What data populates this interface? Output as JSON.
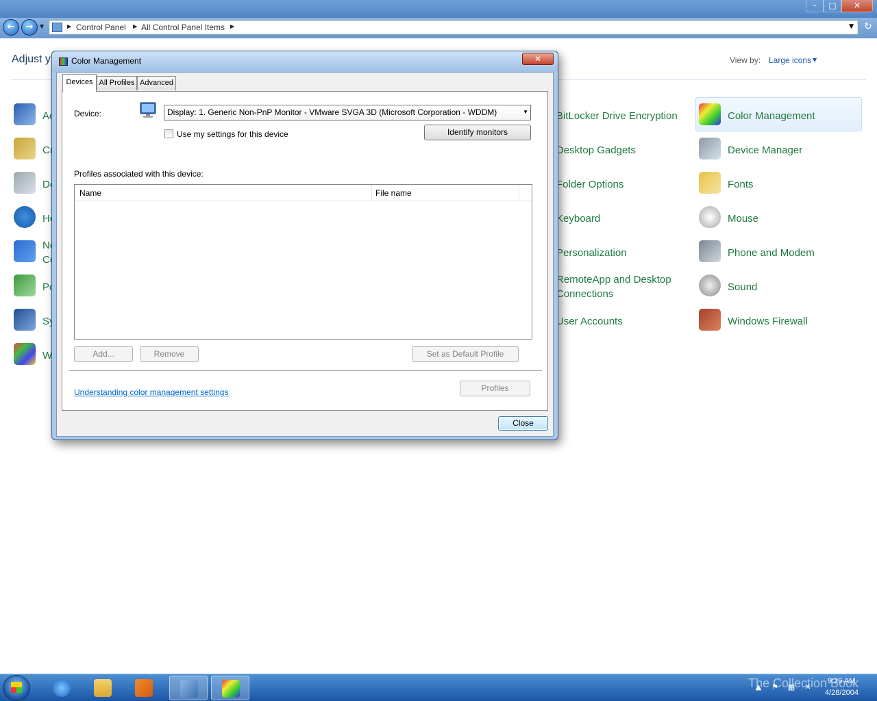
{
  "window": {
    "minimize": "–",
    "maximize": "□",
    "close": "✕"
  },
  "nav": {
    "back_icon": "←",
    "forward_icon": "→",
    "breadcrumbs": [
      "Control Panel",
      "All Control Panel Items"
    ],
    "refresh_icon": "↻"
  },
  "header": {
    "adjust_text": "Adjust y",
    "view_by_label": "View by:",
    "view_by_value": "Large icons"
  },
  "left_items": [
    "Ac",
    "Cr",
    "De",
    "Ho",
    "Ne Ce",
    "Po",
    "Sy",
    "W"
  ],
  "middle_items": [
    "BitLocker Drive Encryption",
    "Desktop Gadgets",
    "Folder Options",
    "Keyboard",
    "Personalization",
    "RemoteApp and Desktop Connections",
    "User Accounts"
  ],
  "right_items": [
    "Color Management",
    "Device Manager",
    "Fonts",
    "Mouse",
    "Phone and Modem",
    "Sound",
    "Windows Firewall"
  ],
  "dialog": {
    "title": "Color Management",
    "close_glyph": "✕",
    "tabs": [
      "Devices",
      "All Profiles",
      "Advanced"
    ],
    "device_label": "Device:",
    "device_value": "Display: 1. Generic Non-PnP Monitor - VMware SVGA 3D (Microsoft Corporation - WDDM)",
    "use_settings_label": "Use my settings for this device",
    "use_settings_checked": false,
    "identify_button": "Identify monitors",
    "profiles_assoc_label": "Profiles associated with this device:",
    "columns": [
      "Name",
      "File name"
    ],
    "add_button": "Add...",
    "remove_button": "Remove",
    "set_default_button": "Set as Default Profile",
    "understanding_link": "Understanding color management settings",
    "profiles_button": "Profiles",
    "close_button": "Close"
  },
  "taskbar": {
    "time": "9:26 AM",
    "date": "4/28/2004",
    "watermark": "The Collection Book"
  }
}
